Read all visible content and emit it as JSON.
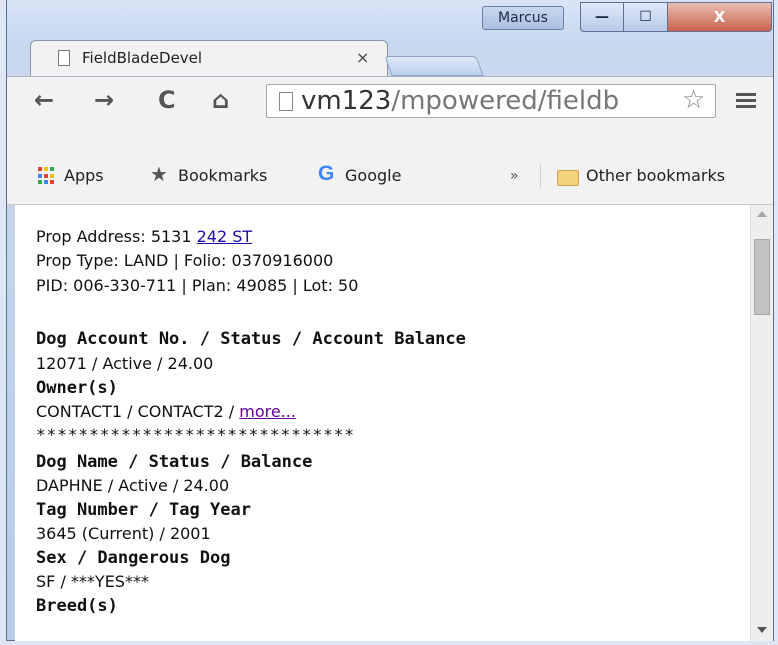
{
  "window": {
    "user": "Marcus",
    "minimize_glyph": "—",
    "maximize_glyph": "☐",
    "close_glyph": "X"
  },
  "tab": {
    "title": "FieldBladeDevel",
    "close_glyph": "×"
  },
  "toolbar": {
    "back_glyph": "←",
    "forward_glyph": "→",
    "reload_glyph": "C",
    "home_glyph": "⌂",
    "url_host": "vm123",
    "url_rest": "/mpowered/fieldb",
    "star_glyph": "☆"
  },
  "bookmarks": {
    "apps": "Apps",
    "bookmarks": "Bookmarks",
    "google": "Google",
    "overflow": "»",
    "other": "Other bookmarks",
    "star_glyph": "★",
    "g_glyph": "G"
  },
  "content": {
    "address_label": "Prop Address: 5131 ",
    "address_link": "242 ST",
    "prop_line": "Prop Type: LAND | Folio: 0370916000",
    "pid_line": "PID: 006-330-711 | Plan: 49085 | Lot: 50",
    "account_heading": "Dog Account No. / Status / Account Balance",
    "account_value": "12071 / Active / 24.00",
    "owners_heading": "Owner(s)",
    "owners_value": "CONTACT1 / CONTACT2 / ",
    "owners_more": "more...",
    "separator": "******************************",
    "dog_heading": "Dog Name / Status / Balance",
    "dog_value": "DAPHNE / Active / 24.00",
    "tag_heading": "Tag Number / Tag Year",
    "tag_value": "3645 (Current) / 2001",
    "sex_heading": "Sex / Dangerous Dog",
    "sex_value": "SF / ***YES***",
    "breed_heading": "Breed(s)"
  },
  "colors": {
    "link": "#1a0dab",
    "visited_link": "#660099",
    "close_button": "#c9604a",
    "google_blue": "#4285f4"
  }
}
